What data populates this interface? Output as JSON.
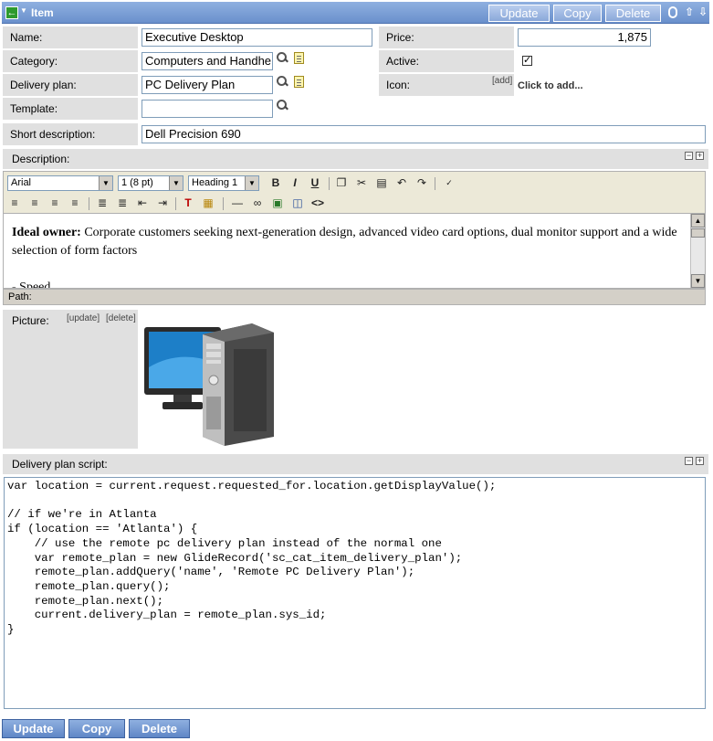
{
  "header": {
    "title": "Item",
    "buttons": {
      "update": "Update",
      "copy": "Copy",
      "delete": "Delete"
    }
  },
  "fields": {
    "name": {
      "label": "Name:",
      "value": "Executive Desktop"
    },
    "price": {
      "label": "Price:",
      "value": "1,875"
    },
    "category": {
      "label": "Category:",
      "value": "Computers and Handhe"
    },
    "active": {
      "label": "Active:",
      "checked": true
    },
    "delivery_plan": {
      "label": "Delivery plan:",
      "value": "PC Delivery Plan"
    },
    "icon": {
      "label": "Icon:",
      "add_link": "[add]",
      "click_to_add": "Click to add..."
    },
    "template": {
      "label": "Template:",
      "value": ""
    },
    "short_description": {
      "label": "Short description:",
      "value": "Dell Precision 690"
    }
  },
  "description": {
    "label": "Description:",
    "toolbar": {
      "font": "Arial",
      "size": "1 (8 pt)",
      "format": "Heading 1"
    },
    "content": {
      "bold_lead": "Ideal owner:",
      "text": " Corporate customers seeking next-generation design, advanced video card options, dual monitor support and a wide selection of form factors",
      "list_item": "- Speed"
    },
    "path_label": "Path:"
  },
  "picture": {
    "label": "Picture:",
    "update_link": "[update]",
    "delete_link": "[delete]"
  },
  "delivery_script": {
    "label": "Delivery plan script:",
    "code": "var location = current.request.requested_for.location.getDisplayValue();\n\n// if we're in Atlanta\nif (location == 'Atlanta') {\n    // use the remote pc delivery plan instead of the normal one\n    var remote_plan = new GlideRecord('sc_cat_item_delivery_plan');\n    remote_plan.addQuery('name', 'Remote PC Delivery Plan');\n    remote_plan.query();\n    remote_plan.next();\n    current.delivery_plan = remote_plan.sys_id;\n}"
  },
  "footer": {
    "buttons": {
      "update": "Update",
      "copy": "Copy",
      "delete": "Delete"
    }
  },
  "colors": {
    "header_bg": "#7a9ed6",
    "label_bg": "#e0e0e0",
    "button_bg": "#6a90cc"
  }
}
